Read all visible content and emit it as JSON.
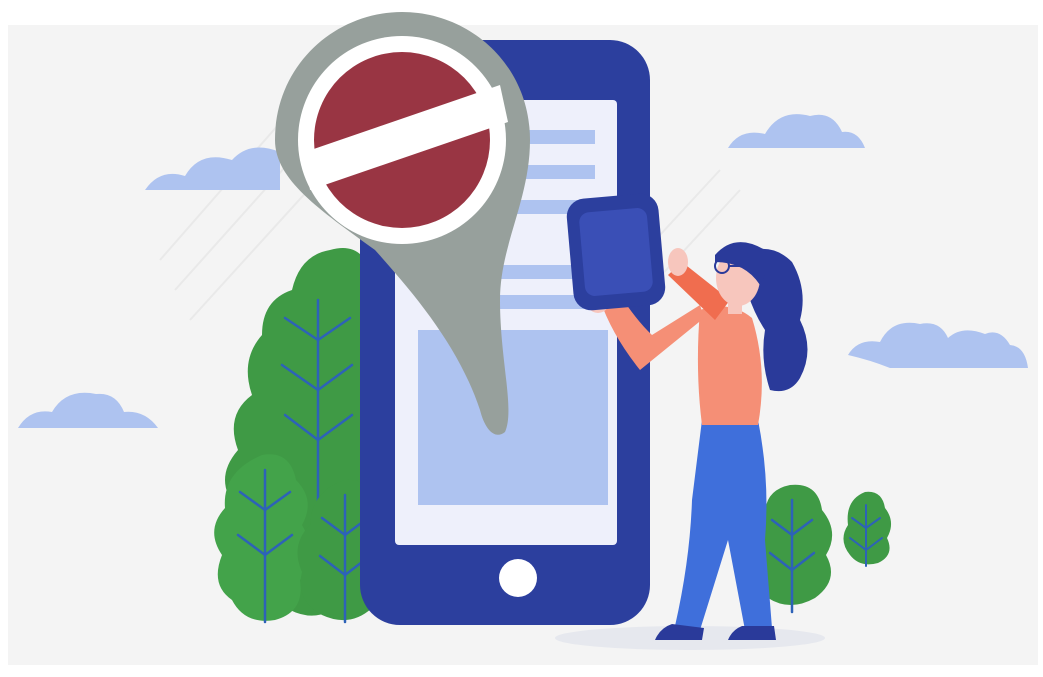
{
  "scene": {
    "background_color": "#f4f4f4",
    "icons": [
      "location-pin-icon",
      "no-entry-icon",
      "smartphone-icon",
      "woman-figure",
      "tree-icon",
      "cloud-icon"
    ],
    "colors": {
      "pin_gray": "#97a09c",
      "no_entry_red": "#993543",
      "phone_blue": "#2c3f9e",
      "screen_light": "#eef0fb",
      "screen_block": "#aec3f0",
      "tree_green": "#3f9a45",
      "cloud_blue": "#aec3f0",
      "shirt_salmon": "#f58f76",
      "pants_blue": "#3f6fdb",
      "hair_navy": "#2a3a9a"
    }
  }
}
